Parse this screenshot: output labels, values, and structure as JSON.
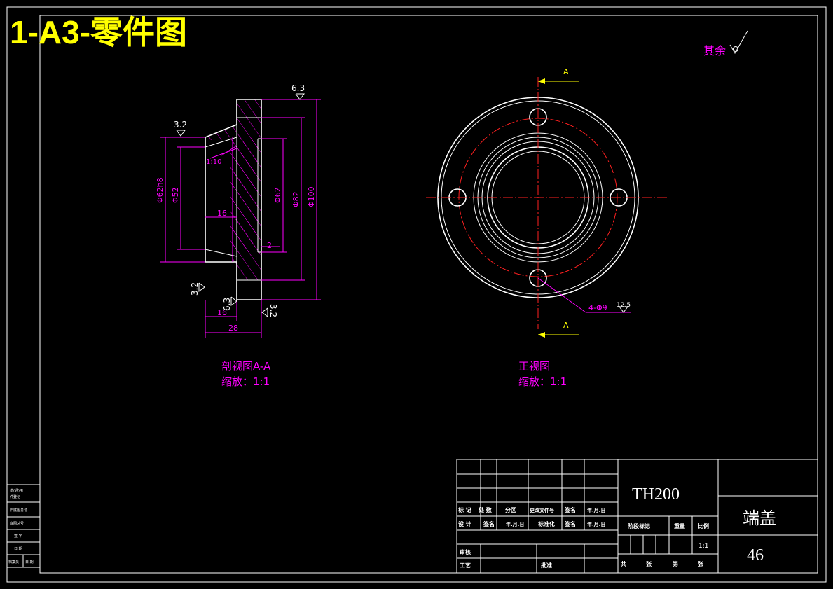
{
  "header": {
    "title": "1-A3-零件图"
  },
  "surface_finish_note": {
    "label": "其余"
  },
  "section_view": {
    "roughness": {
      "top": "6.3",
      "left_top": "3.2",
      "bottom_left": "3.2",
      "bottom_mid": "6.3",
      "bottom_right": "3.2"
    },
    "taper": "1:10",
    "dims": {
      "phi62h8": "Φ62h8",
      "phi52": "Φ52",
      "phi62": "Φ62",
      "phi82": "Φ82",
      "phi100": "Φ100",
      "len16": "16",
      "gap2": "2",
      "base16": "16",
      "total28": "28"
    },
    "caption": "剖视图A-A",
    "scale": "缩放：1:1"
  },
  "front_view": {
    "section_mark_top": "A",
    "section_mark_bottom": "A",
    "holes_label": "4-Φ9",
    "hole_roughness": "12.5",
    "caption": "正视图",
    "scale": "缩放：1:1"
  },
  "left_strip": {
    "rows": [
      "借(通)用",
      "件登记",
      "旧底图总号",
      "底图总号",
      "签 字",
      "日 期",
      "档案员",
      "日 期"
    ]
  },
  "title_block": {
    "drawing_no": "TH200",
    "part_name": "端盖",
    "number": "46",
    "scale_value": "1:1",
    "labels": {
      "biaoji": "标 记",
      "chushu": "处 数",
      "fenqu": "分区",
      "genggai": "更改文件号",
      "qianming1": "签名",
      "nianyueri1": "年.月.日",
      "sheji": "设 计",
      "qianming2": "签名",
      "nianyueri2": "年.月.日",
      "biaozhunhua": "标准化",
      "qianming3": "签名",
      "nianyueri3": "年.月.日",
      "jieduan": "阶段标记",
      "zhongliang": "重量",
      "bili": "比例",
      "shenhe": "审核",
      "gongyi": "工艺",
      "pizhun": "批准",
      "gong": "共",
      "zhang1": "张",
      "di": "第",
      "zhang2": "张"
    }
  }
}
